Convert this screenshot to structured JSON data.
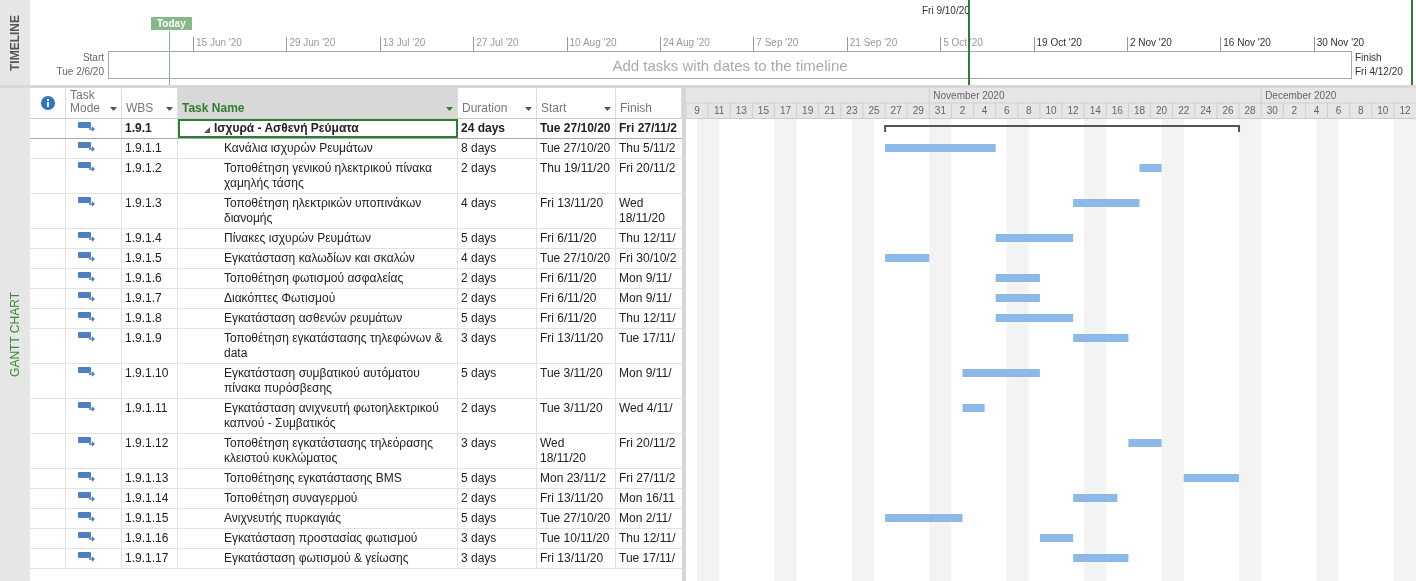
{
  "timeline": {
    "label": "TIMELINE",
    "today_label": "Today",
    "current_marker": "Fri 9/10/20",
    "start_label": "Start",
    "start_date": "Tue 2/6/20",
    "finish_label": "Finish",
    "finish_date": "Fri 4/12/20",
    "placeholder": "Add tasks with dates to the timeline",
    "ticks": [
      {
        "label": "15 Jun '20",
        "emphasized": false
      },
      {
        "label": "29 Jun '20",
        "emphasized": false
      },
      {
        "label": "13 Jul '20",
        "emphasized": false
      },
      {
        "label": "27 Jul '20",
        "emphasized": false
      },
      {
        "label": "10 Aug '20",
        "emphasized": false
      },
      {
        "label": "24 Aug '20",
        "emphasized": false
      },
      {
        "label": "7 Sep '20",
        "emphasized": false
      },
      {
        "label": "21 Sep '20",
        "emphasized": false
      },
      {
        "label": "5 Oct '20",
        "emphasized": false
      },
      {
        "label": "19 Oct '20",
        "emphasized": true
      },
      {
        "label": "2 Nov '20",
        "emphasized": true
      },
      {
        "label": "16 Nov '20",
        "emphasized": true
      },
      {
        "label": "30 Nov '20",
        "emphasized": true
      }
    ]
  },
  "view_label": "GANTT CHART",
  "table": {
    "columns": [
      {
        "kind": "info",
        "selected": false
      },
      {
        "kind": "text",
        "label": "Task Mode",
        "selected": false,
        "menu": true
      },
      {
        "kind": "text",
        "label": "WBS",
        "selected": false,
        "menu": true
      },
      {
        "kind": "text",
        "label": "Task Name",
        "selected": true,
        "menu": true
      },
      {
        "kind": "text",
        "label": "Duration",
        "selected": false,
        "menu": true
      },
      {
        "kind": "text",
        "label": "Start",
        "selected": false,
        "menu": true
      },
      {
        "kind": "text",
        "label": "Finish",
        "selected": false,
        "menu": false
      }
    ],
    "rows": [
      {
        "kind": "summary",
        "expanded": true,
        "selected": true,
        "wbs": "1.9.1",
        "name": "Ισχυρά - Ασθενή Ρεύματα",
        "duration": "24 days",
        "start": "Tue 27/10/20",
        "finish": "Fri 27/11/2"
      },
      {
        "kind": "task",
        "selected": false,
        "wbs": "1.9.1.1",
        "name": "Κανάλια ισχυρών Ρευμάτων",
        "duration": "8 days",
        "start": "Tue 27/10/20",
        "finish": "Thu 5/11/2"
      },
      {
        "kind": "task",
        "selected": false,
        "wbs": "1.9.1.2",
        "name": "Τοποθέτηση γενικού ηλεκτρικού πίνακα χαμηλής τάσης",
        "duration": "2 days",
        "start": "Thu 19/11/20",
        "finish": "Fri 20/11/2"
      },
      {
        "kind": "task",
        "selected": false,
        "wbs": "1.9.1.3",
        "name": "Τοποθέτηση ηλεκτρικών υποπινάκων διανομής",
        "duration": "4 days",
        "start": "Fri 13/11/20",
        "finish": "Wed 18/11/20"
      },
      {
        "kind": "task",
        "selected": false,
        "wbs": "1.9.1.4",
        "name": "Πίνακες ισχυρών Ρευμάτων",
        "duration": "5 days",
        "start": "Fri 6/11/20",
        "finish": "Thu 12/11/"
      },
      {
        "kind": "task",
        "selected": false,
        "wbs": "1.9.1.5",
        "name": "Εγκατάσταση καλωδίων και σκαλών",
        "duration": "4 days",
        "start": "Tue 27/10/20",
        "finish": "Fri 30/10/2"
      },
      {
        "kind": "task",
        "selected": false,
        "wbs": "1.9.1.6",
        "name": "Τοποθέτηση φωτισμού ασφαλείας",
        "duration": "2 days",
        "start": "Fri 6/11/20",
        "finish": "Mon 9/11/"
      },
      {
        "kind": "task",
        "selected": false,
        "wbs": "1.9.1.7",
        "name": "Διακόπτες Φωτισμού",
        "duration": "2 days",
        "start": "Fri 6/11/20",
        "finish": "Mon 9/11/"
      },
      {
        "kind": "task",
        "selected": false,
        "wbs": "1.9.1.8",
        "name": "Εγκατάσταση ασθενών ρευμάτων",
        "duration": "5 days",
        "start": "Fri 6/11/20",
        "finish": "Thu 12/11/"
      },
      {
        "kind": "task",
        "selected": false,
        "wbs": "1.9.1.9",
        "name": "Τοποθέτηση εγκατάστασης τηλεφώνων & data",
        "duration": "3 days",
        "start": "Fri 13/11/20",
        "finish": "Tue 17/11/"
      },
      {
        "kind": "task",
        "selected": false,
        "wbs": "1.9.1.10",
        "name": "Εγκατάσταση συμβατικού αυτόματου πίνακα πυρόσβεσης",
        "duration": "5 days",
        "start": "Tue 3/11/20",
        "finish": "Mon 9/11/"
      },
      {
        "kind": "task",
        "selected": false,
        "wbs": "1.9.1.11",
        "name": "Εγκατάσταση ανιχνευτή φωτοηλεκτρικού καπνού - Συμβατικός",
        "duration": "2 days",
        "start": "Tue 3/11/20",
        "finish": "Wed 4/11/"
      },
      {
        "kind": "task",
        "selected": false,
        "wbs": "1.9.1.12",
        "name": "Τοποθέτηση εγκατάστασης τηλεόρασης κλειστού κυκλώματος",
        "duration": "3 days",
        "start": "Wed 18/11/20",
        "finish": "Fri 20/11/2"
      },
      {
        "kind": "task",
        "selected": false,
        "wbs": "1.9.1.13",
        "name": "Τοποθέτησης εγκατάστασης BMS",
        "duration": "5 days",
        "start": "Mon 23/11/2",
        "finish": "Fri 27/11/2"
      },
      {
        "kind": "task",
        "selected": false,
        "wbs": "1.9.1.14",
        "name": "Τοποθέτηση συναγερμού",
        "duration": "2 days",
        "start": "Fri 13/11/20",
        "finish": "Mon 16/11"
      },
      {
        "kind": "task",
        "selected": false,
        "wbs": "1.9.1.15",
        "name": "Ανιχνευτής πυρκαγιάς",
        "duration": "5 days",
        "start": "Tue 27/10/20",
        "finish": "Mon 2/11/"
      },
      {
        "kind": "task",
        "selected": false,
        "wbs": "1.9.1.16",
        "name": "Εγκατάσταση προστασίας φωτισμού",
        "duration": "3 days",
        "start": "Tue 10/11/20",
        "finish": "Thu 12/11/"
      },
      {
        "kind": "task",
        "selected": false,
        "wbs": "1.9.1.17",
        "name": "Εγκατάσταση φωτισμού & γείωσης",
        "duration": "3 days",
        "start": "Fri 13/11/20",
        "finish": "Tue 17/11/"
      }
    ]
  },
  "chart": {
    "months": [
      "November 2020",
      "December 2020"
    ],
    "day_labels": [
      "9",
      "11",
      "13",
      "15",
      "17",
      "19",
      "21",
      "23",
      "25",
      "27",
      "29",
      "31",
      "2",
      "4",
      "6",
      "8",
      "10",
      "12",
      "14",
      "16",
      "18",
      "20",
      "22",
      "24",
      "26",
      "28",
      "30",
      "2",
      "4",
      "6",
      "8",
      "10",
      "12"
    ]
  }
}
